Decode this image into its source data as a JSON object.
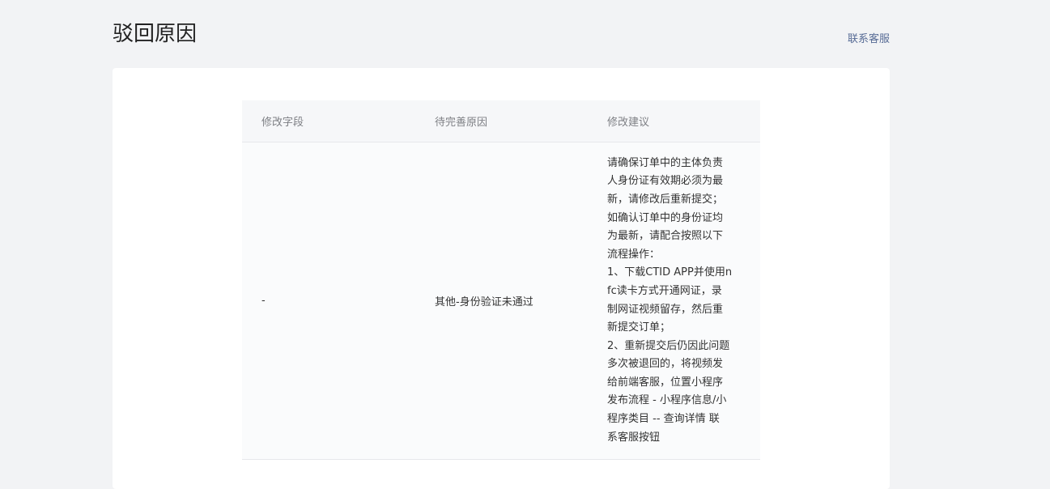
{
  "header": {
    "title": "驳回原因",
    "contact_label": "联系客服"
  },
  "table": {
    "columns": [
      "修改字段",
      "待完善原因",
      "修改建议"
    ],
    "rows": [
      {
        "field": "-",
        "reason": "其他-身份验证未通过",
        "suggestion_lines": [
          "请确保订单中的主体负责",
          "人身份证有效期必须为最",
          "新，请修改后重新提交；",
          "如确认订单中的身份证均",
          "为最新，请配合按照以下",
          "流程操作：",
          "1、下载CTID APP并使用n",
          "fc读卡方式开通网证，录",
          "制网证视频留存，然后重",
          "新提交订单；",
          "2、重新提交后仍因此问题",
          "多次被退回的，将视频发",
          "给前端客服，位置小程序",
          "发布流程 - 小程序信息/小",
          "程序类目 -- 查询详情  联",
          "系客服按钮"
        ]
      }
    ]
  }
}
